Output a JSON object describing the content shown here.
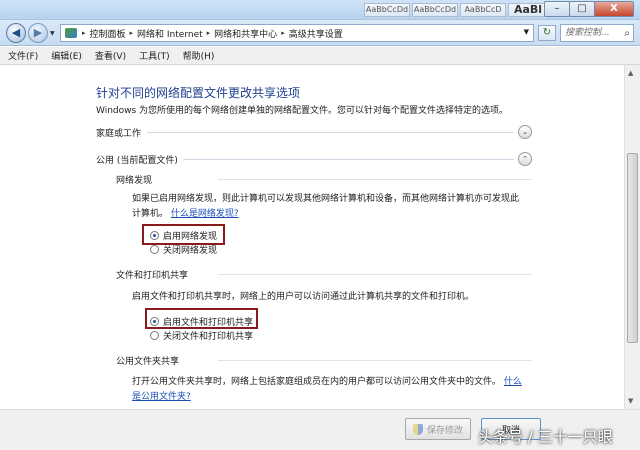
{
  "titlebar": {
    "thumbnails": [
      "AaBbCcDd",
      "AaBbCcDd",
      "AaBbCcD",
      "AaBl"
    ],
    "minimize_glyph": "–",
    "maximize_glyph": "□",
    "close_glyph": "X"
  },
  "nav": {
    "back_glyph": "◀",
    "forward_glyph": "▶",
    "breadcrumb": [
      "控制面板",
      "网络和 Internet",
      "网络和共享中心",
      "高级共享设置"
    ],
    "separator_glyph": "▸",
    "dropdown_glyph": "▼",
    "refresh_glyph": "↻",
    "search_placeholder": "搜索控制...",
    "search_glyph": "⌕"
  },
  "menubar": {
    "items": [
      "文件(F)",
      "编辑(E)",
      "查看(V)",
      "工具(T)",
      "帮助(H)"
    ]
  },
  "content": {
    "title": "针对不同的网络配置文件更改共享选项",
    "description": "Windows 为您所使用的每个网络创建单独的网络配置文件。您可以针对每个配置文件选择特定的选项。",
    "sections": {
      "home": {
        "label": "家庭或工作",
        "toggle_glyph": "⌄"
      },
      "public": {
        "label": "公用 (当前配置文件)",
        "toggle_glyph": "⌃"
      }
    },
    "network_discovery": {
      "heading": "网络发现",
      "text_line1": "如果已启用网络发现，则此计算机可以发现其他网络计算机和设备，而其他网络计算机亦可发现此",
      "text_line2": "计算机。",
      "link": "什么是网络发现?",
      "option_on": "启用网络发现",
      "option_off": "关闭网络发现"
    },
    "file_printer_sharing": {
      "heading": "文件和打印机共享",
      "text": "启用文件和打印机共享时，网络上的用户可以访问通过此计算机共享的文件和打印机。",
      "option_on": "启用文件和打印机共享",
      "option_off": "关闭文件和打印机共享"
    },
    "public_folder_sharing": {
      "heading": "公用文件夹共享",
      "text_line1": "打开公用文件夹共享时，网络上包括家庭组成员在内的用户都可以访问公用文件夹中的文件。",
      "link_part1": "什么",
      "link_part2": "是公用文件夹?"
    }
  },
  "scrollbar": {
    "up_glyph": "▲",
    "down_glyph": "▼"
  },
  "footer": {
    "save_label": "保存修改",
    "cancel_label": "取消",
    "watermark": "头条号 / 三十一只眼"
  }
}
